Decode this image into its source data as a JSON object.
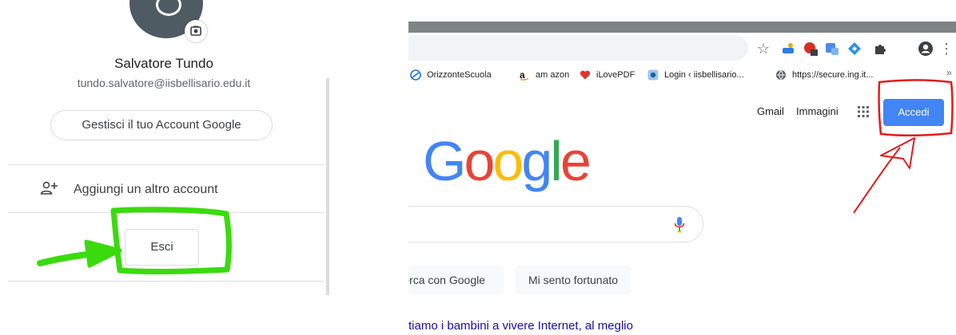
{
  "account_menu": {
    "name": "Salvatore Tundo",
    "email": "tundo.salvatore@iisbellisario.edu.it",
    "manage_label": "Gestisci il tuo Account Google",
    "add_account_label": "Aggiungi un altro account",
    "signout_label": "Esci"
  },
  "browser": {
    "toolbar_icons": [
      "star-icon",
      "extension-icon",
      "extension-icon",
      "extension-icon",
      "extension-icon",
      "puzzle-icon",
      "profile-icon",
      "menu-icon"
    ],
    "bookmarks": [
      {
        "label": "OrizzonteScuola",
        "icon": "globe-icon"
      },
      {
        "label": "am azon",
        "icon": "amazon-icon"
      },
      {
        "label": "iLovePDF",
        "icon": "heart-icon"
      },
      {
        "label": "Login ‹ iisbellisario...",
        "icon": "site-icon"
      },
      {
        "label": "https://secure.ing.it...",
        "icon": "globe-icon"
      }
    ],
    "bookmarks_more": "»"
  },
  "google": {
    "header_links": {
      "gmail": "Gmail",
      "images": "Immagini"
    },
    "signin_label": "Accedi",
    "logo_text": "Google",
    "search_button": "erca con Google",
    "lucky_button": "Mi sento fortunato",
    "promo_text": "tiamo i bambini a vivere Internet, al meglio"
  },
  "colors": {
    "annotation_green": "#3adb0c",
    "annotation_red": "#e21b1b",
    "google_blue": "#4285f4"
  }
}
